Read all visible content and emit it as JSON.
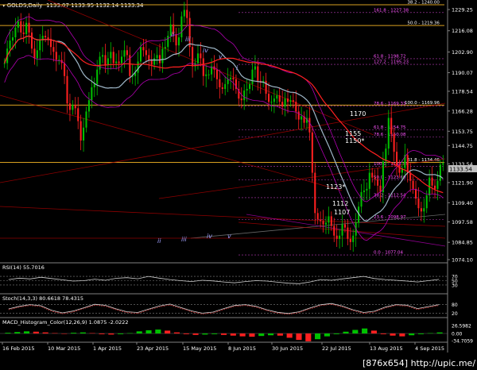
{
  "window": {
    "title_prefix": "▾ GOLDS,Daily",
    "ohlc": "1133.07 1133.95 1132.14 1133.34",
    "corner_badge": "[876x654] http://upic.me/"
  },
  "colors": {
    "bg": "#000000",
    "bull": "#00c000",
    "bear": "#ff2020",
    "ma_fast": "#ff2020",
    "ma_slow": "#9fb7c8",
    "envelope": "#b000b0",
    "fib": "#d9a020",
    "fib_label": "#ff55ff",
    "panel_sep": "#808080",
    "axis_text": "#ffffff"
  },
  "chart_data": {
    "type": "candlestick",
    "symbol": "GOLDS",
    "timeframe": "Daily",
    "x_labels": [
      "16 Feb 2015",
      "10 Mar 2015",
      "1 Apr 2015",
      "23 Apr 2015",
      "15 May 2015",
      "8 Jun 2015",
      "30 Jun 2015",
      "22 Jul 2015",
      "13 Aug 2015",
      "4 Sep 2015"
    ],
    "y_ticks": [
      "1229.25",
      "1216.08",
      "1202.90",
      "1190.07",
      "1178.54",
      "1166.28",
      "1153.75",
      "1144.75",
      "1133.54",
      "1121.90",
      "1109.40",
      "1097.58",
      "1084.85",
      "1074.10"
    ],
    "y_range": [
      1074.1,
      1229.25
    ],
    "current_price": "1133.54",
    "closes": [
      1196,
      1205,
      1210,
      1212,
      1218,
      1222,
      1215,
      1214,
      1221,
      1215,
      1205,
      1199,
      1204,
      1210,
      1213,
      1212,
      1211,
      1206,
      1203,
      1198,
      1198,
      1196,
      1188,
      1171,
      1167,
      1170,
      1168,
      1160,
      1148,
      1156,
      1166,
      1173,
      1181,
      1183,
      1192,
      1200,
      1201,
      1195,
      1199,
      1203,
      1196,
      1197,
      1196,
      1200,
      1204,
      1201,
      1188,
      1188,
      1190,
      1197,
      1206,
      1204,
      1201,
      1198,
      1195,
      1199,
      1201,
      1196,
      1205,
      1206,
      1213,
      1220,
      1214,
      1207,
      1212,
      1225,
      1229,
      1224,
      1206,
      1194,
      1196,
      1202,
      1199,
      1188,
      1189,
      1189,
      1194,
      1192,
      1186,
      1181,
      1180,
      1183,
      1186,
      1187,
      1186,
      1180,
      1174,
      1173,
      1179,
      1180,
      1183,
      1192,
      1194,
      1185,
      1184,
      1185,
      1177,
      1172,
      1172,
      1174,
      1176,
      1172,
      1169,
      1174,
      1172,
      1173,
      1172,
      1166,
      1161,
      1163,
      1159,
      1162,
      1153,
      1128,
      1103,
      1099,
      1098,
      1096,
      1097,
      1101,
      1095,
      1089,
      1087,
      1089,
      1096,
      1094,
      1087,
      1085,
      1089,
      1097,
      1107,
      1116,
      1117,
      1118,
      1128,
      1125,
      1124,
      1120,
      1116,
      1135,
      1143,
      1162,
      1152,
      1141,
      1133,
      1128,
      1131,
      1139,
      1128,
      1123,
      1118,
      1112,
      1106,
      1104,
      1106,
      1114,
      1125,
      1120,
      1118,
      1123,
      1133,
      1134
    ],
    "fib_levels": [
      {
        "label": "38.2 - 1240.00"
      },
      {
        "label": "161.8 - 1227.38"
      },
      {
        "label": "50.0 - 1219.36"
      },
      {
        "label": "61.8 - 1198.72"
      },
      {
        "label": "127.2 - 1195.23"
      },
      {
        "label": "100.0 - 1169.96"
      },
      {
        "label": "78.6 - 1169.33"
      },
      {
        "label": "61.8 - 1154.75"
      },
      {
        "label": "78.6 - 1150.08"
      },
      {
        "label": "61.8 - 1134.46"
      },
      {
        "label": "100.0 - 1131.89"
      },
      {
        "label": "50.0 - 1123.60"
      },
      {
        "label": "38.2 - 1112.54"
      },
      {
        "label": "23.6 - 1098.97"
      },
      {
        "label": "0.0 - 1077.04"
      }
    ],
    "price_annotations": [
      "1170",
      "1155",
      "1150*",
      "1123*",
      "1112",
      "1107"
    ],
    "wave_labels": [
      "ii",
      "iii",
      "iv",
      "v",
      "i",
      "ii",
      "iii",
      "iv",
      "v"
    ]
  },
  "indicators": {
    "rsi": {
      "label": "RSI(14) 55.7016",
      "levels": [
        "70",
        "50",
        "30"
      ],
      "values": [
        55,
        62,
        58,
        66,
        60,
        54,
        48,
        50,
        57,
        52,
        61,
        64,
        59,
        70,
        62,
        55,
        50,
        46,
        52,
        49,
        44,
        40,
        46,
        50,
        48,
        43,
        38,
        36,
        44,
        55,
        52,
        58,
        64,
        70,
        60,
        55,
        52,
        48,
        44,
        50,
        56
      ]
    },
    "stoch": {
      "label": "Stoch(14,3,3) 80.6618 78.4315",
      "levels": [
        "80",
        "20"
      ],
      "values": [
        50,
        68,
        80,
        72,
        40,
        22,
        35,
        58,
        82,
        75,
        50,
        30,
        25,
        48,
        70,
        84,
        60,
        36,
        20,
        28,
        52,
        74,
        80,
        68,
        44,
        26,
        18,
        30,
        56,
        79,
        88,
        70,
        44,
        25,
        34,
        62,
        80,
        76,
        52,
        66,
        80
      ]
    },
    "macd": {
      "label": "MACD_Histogram_Color(12,26,9) 1.0875 -2.0222",
      "levels": [
        "26.5982",
        "0.00",
        "-34.7059"
      ],
      "values": [
        2,
        4,
        6,
        5,
        3,
        1,
        -1,
        2,
        3,
        1,
        -2,
        -3,
        -2,
        1,
        6,
        9,
        11,
        8,
        3,
        -2,
        -4,
        -3,
        -2,
        -4,
        -6,
        -8,
        -9,
        -7,
        -5,
        -6,
        -12,
        -18,
        -22,
        -16,
        -8,
        -2,
        5,
        10,
        14,
        8,
        -2,
        -6,
        -8,
        -5,
        -2,
        1,
        3
      ]
    }
  }
}
